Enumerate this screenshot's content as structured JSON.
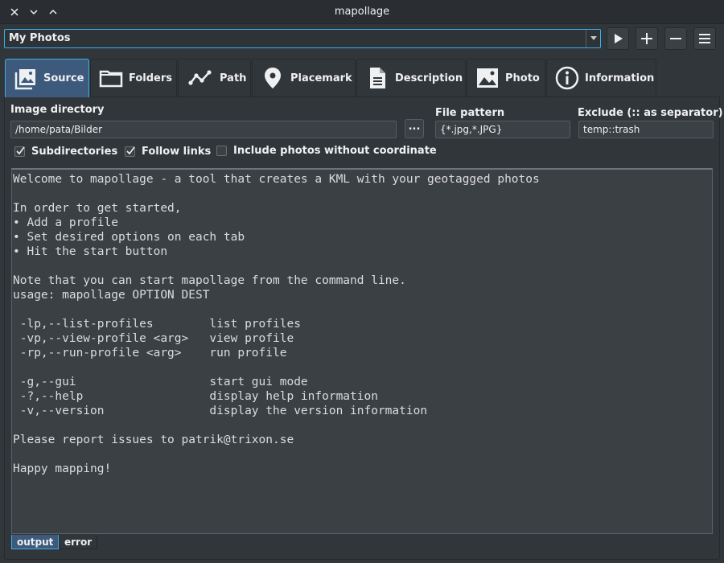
{
  "window": {
    "title": "mapollage"
  },
  "profile": {
    "selected": "My Photos"
  },
  "tabs": [
    {
      "label": "Source",
      "icon": "image-stack-icon",
      "active": true
    },
    {
      "label": "Folders",
      "icon": "folder-icon"
    },
    {
      "label": "Path",
      "icon": "path-icon"
    },
    {
      "label": "Placemark",
      "icon": "placemark-icon"
    },
    {
      "label": "Description",
      "icon": "document-icon"
    },
    {
      "label": "Photo",
      "icon": "photo-icon"
    },
    {
      "label": "Information",
      "icon": "info-icon"
    }
  ],
  "source": {
    "image_directory_label": "Image directory",
    "image_directory_value": "/home/pata/Bilder",
    "browse_label": "...",
    "file_pattern_label": "File pattern",
    "file_pattern_value": "{*.jpg,*.JPG}",
    "exclude_label": "Exclude (:: as separator)",
    "exclude_value": "temp::trash",
    "subdirectories_label": "Subdirectories",
    "subdirectories_checked": true,
    "follow_links_label": "Follow links",
    "follow_links_checked": true,
    "include_no_coord_label": "Include photos without coordinate",
    "include_no_coord_checked": false
  },
  "console": {
    "lines": [
      "Welcome to mapollage - a tool that creates a KML with your geotagged photos",
      "",
      "In order to get started,",
      "• Add a profile",
      "• Set desired options on each tab",
      "• Hit the start button",
      "",
      "Note that you can start mapollage from the command line.",
      "usage: mapollage OPTION DEST",
      "",
      " -lp,--list-profiles        list profiles",
      " -vp,--view-profile <arg>   view profile",
      " -rp,--run-profile <arg>    run profile",
      "",
      " -g,--gui                   start gui mode",
      " -?,--help                  display help information",
      " -v,--version               display the version information",
      "",
      "Please report issues to patrik@trixon.se",
      "",
      "Happy mapping!"
    ]
  },
  "output_tabs": [
    {
      "label": "output",
      "active": true
    },
    {
      "label": "error"
    }
  ],
  "colors": {
    "accent": "#3daee9",
    "background": "#31363b"
  }
}
